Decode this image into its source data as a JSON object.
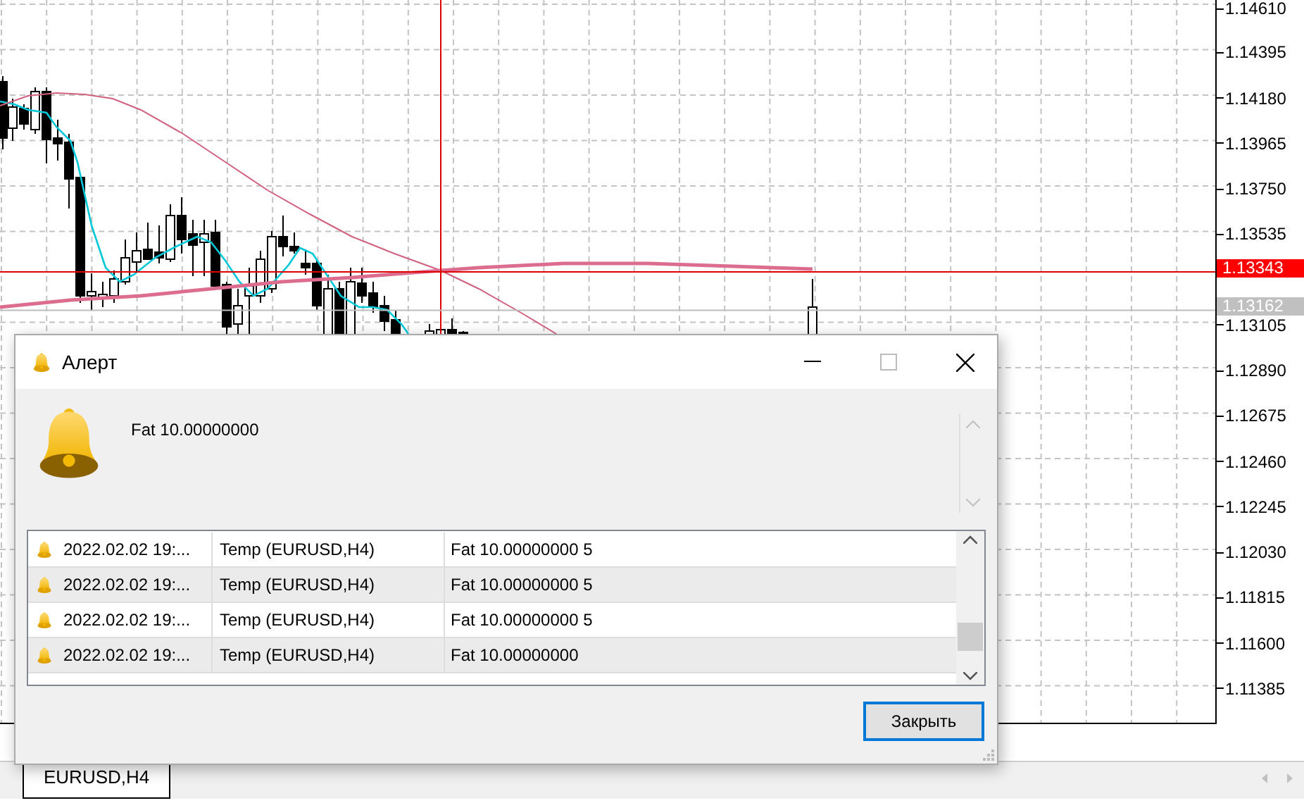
{
  "chart": {
    "price_axis": [
      "1.14610",
      "1.14395",
      "1.14180",
      "1.13965",
      "1.13750",
      "1.13535",
      "1.13105",
      "1.12890",
      "1.12675",
      "1.12460",
      "1.12245",
      "1.12030",
      "1.11815",
      "1.11600",
      "1.11385"
    ],
    "price_markers": [
      {
        "label": "1.13343",
        "kind": "current"
      },
      {
        "label": "1.13162",
        "kind": "bid"
      }
    ]
  },
  "alert_dialog": {
    "title": "Алерт",
    "message": "Fat 10.00000000",
    "rows": [
      {
        "time": "2022.02.02 19:...",
        "source": "Temp (EURUSD,H4)",
        "message": "Fat 10.00000000 5"
      },
      {
        "time": "2022.02.02 19:...",
        "source": "Temp (EURUSD,H4)",
        "message": "Fat 10.00000000 5"
      },
      {
        "time": "2022.02.02 19:...",
        "source": "Temp (EURUSD,H4)",
        "message": "Fat 10.00000000 5"
      },
      {
        "time": "2022.02.02 19:...",
        "source": "Temp (EURUSD,H4)",
        "message": "Fat 10.00000000"
      }
    ],
    "close_button": "Закрыть"
  },
  "chart_tabs": [
    {
      "label": "EURUSD,H4",
      "selected": true
    }
  ]
}
